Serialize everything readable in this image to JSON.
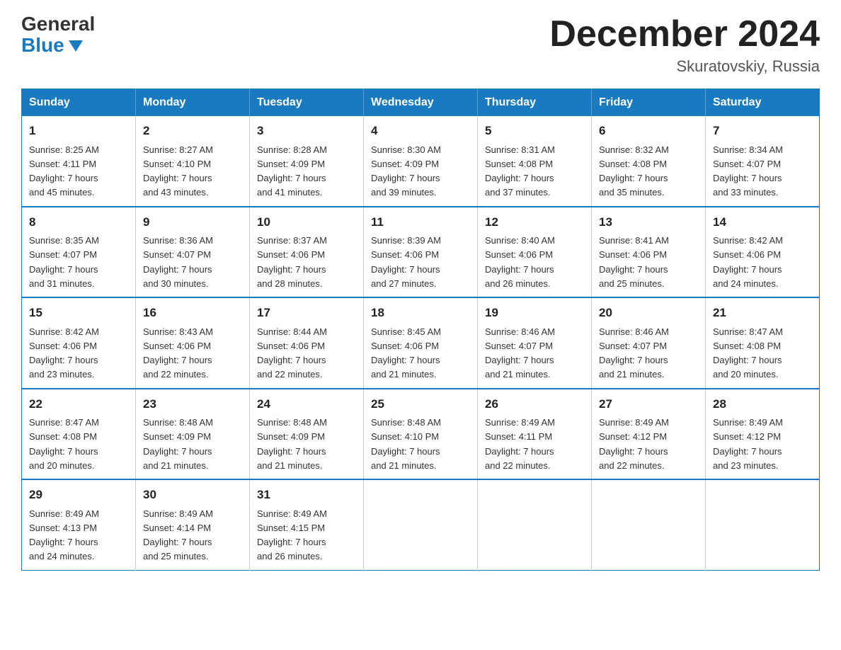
{
  "header": {
    "logo": {
      "general": "General",
      "blue": "Blue"
    },
    "title": "December 2024",
    "location": "Skuratovskiy, Russia"
  },
  "days_of_week": [
    "Sunday",
    "Monday",
    "Tuesday",
    "Wednesday",
    "Thursday",
    "Friday",
    "Saturday"
  ],
  "weeks": [
    [
      {
        "day": "1",
        "sunrise": "8:25 AM",
        "sunset": "4:11 PM",
        "daylight": "7 hours and 45 minutes."
      },
      {
        "day": "2",
        "sunrise": "8:27 AM",
        "sunset": "4:10 PM",
        "daylight": "7 hours and 43 minutes."
      },
      {
        "day": "3",
        "sunrise": "8:28 AM",
        "sunset": "4:09 PM",
        "daylight": "7 hours and 41 minutes."
      },
      {
        "day": "4",
        "sunrise": "8:30 AM",
        "sunset": "4:09 PM",
        "daylight": "7 hours and 39 minutes."
      },
      {
        "day": "5",
        "sunrise": "8:31 AM",
        "sunset": "4:08 PM",
        "daylight": "7 hours and 37 minutes."
      },
      {
        "day": "6",
        "sunrise": "8:32 AM",
        "sunset": "4:08 PM",
        "daylight": "7 hours and 35 minutes."
      },
      {
        "day": "7",
        "sunrise": "8:34 AM",
        "sunset": "4:07 PM",
        "daylight": "7 hours and 33 minutes."
      }
    ],
    [
      {
        "day": "8",
        "sunrise": "8:35 AM",
        "sunset": "4:07 PM",
        "daylight": "7 hours and 31 minutes."
      },
      {
        "day": "9",
        "sunrise": "8:36 AM",
        "sunset": "4:07 PM",
        "daylight": "7 hours and 30 minutes."
      },
      {
        "day": "10",
        "sunrise": "8:37 AM",
        "sunset": "4:06 PM",
        "daylight": "7 hours and 28 minutes."
      },
      {
        "day": "11",
        "sunrise": "8:39 AM",
        "sunset": "4:06 PM",
        "daylight": "7 hours and 27 minutes."
      },
      {
        "day": "12",
        "sunrise": "8:40 AM",
        "sunset": "4:06 PM",
        "daylight": "7 hours and 26 minutes."
      },
      {
        "day": "13",
        "sunrise": "8:41 AM",
        "sunset": "4:06 PM",
        "daylight": "7 hours and 25 minutes."
      },
      {
        "day": "14",
        "sunrise": "8:42 AM",
        "sunset": "4:06 PM",
        "daylight": "7 hours and 24 minutes."
      }
    ],
    [
      {
        "day": "15",
        "sunrise": "8:42 AM",
        "sunset": "4:06 PM",
        "daylight": "7 hours and 23 minutes."
      },
      {
        "day": "16",
        "sunrise": "8:43 AM",
        "sunset": "4:06 PM",
        "daylight": "7 hours and 22 minutes."
      },
      {
        "day": "17",
        "sunrise": "8:44 AM",
        "sunset": "4:06 PM",
        "daylight": "7 hours and 22 minutes."
      },
      {
        "day": "18",
        "sunrise": "8:45 AM",
        "sunset": "4:06 PM",
        "daylight": "7 hours and 21 minutes."
      },
      {
        "day": "19",
        "sunrise": "8:46 AM",
        "sunset": "4:07 PM",
        "daylight": "7 hours and 21 minutes."
      },
      {
        "day": "20",
        "sunrise": "8:46 AM",
        "sunset": "4:07 PM",
        "daylight": "7 hours and 21 minutes."
      },
      {
        "day": "21",
        "sunrise": "8:47 AM",
        "sunset": "4:08 PM",
        "daylight": "7 hours and 20 minutes."
      }
    ],
    [
      {
        "day": "22",
        "sunrise": "8:47 AM",
        "sunset": "4:08 PM",
        "daylight": "7 hours and 20 minutes."
      },
      {
        "day": "23",
        "sunrise": "8:48 AM",
        "sunset": "4:09 PM",
        "daylight": "7 hours and 21 minutes."
      },
      {
        "day": "24",
        "sunrise": "8:48 AM",
        "sunset": "4:09 PM",
        "daylight": "7 hours and 21 minutes."
      },
      {
        "day": "25",
        "sunrise": "8:48 AM",
        "sunset": "4:10 PM",
        "daylight": "7 hours and 21 minutes."
      },
      {
        "day": "26",
        "sunrise": "8:49 AM",
        "sunset": "4:11 PM",
        "daylight": "7 hours and 22 minutes."
      },
      {
        "day": "27",
        "sunrise": "8:49 AM",
        "sunset": "4:12 PM",
        "daylight": "7 hours and 22 minutes."
      },
      {
        "day": "28",
        "sunrise": "8:49 AM",
        "sunset": "4:12 PM",
        "daylight": "7 hours and 23 minutes."
      }
    ],
    [
      {
        "day": "29",
        "sunrise": "8:49 AM",
        "sunset": "4:13 PM",
        "daylight": "7 hours and 24 minutes."
      },
      {
        "day": "30",
        "sunrise": "8:49 AM",
        "sunset": "4:14 PM",
        "daylight": "7 hours and 25 minutes."
      },
      {
        "day": "31",
        "sunrise": "8:49 AM",
        "sunset": "4:15 PM",
        "daylight": "7 hours and 26 minutes."
      },
      {
        "day": "",
        "sunrise": "",
        "sunset": "",
        "daylight": ""
      },
      {
        "day": "",
        "sunrise": "",
        "sunset": "",
        "daylight": ""
      },
      {
        "day": "",
        "sunrise": "",
        "sunset": "",
        "daylight": ""
      },
      {
        "day": "",
        "sunrise": "",
        "sunset": "",
        "daylight": ""
      }
    ]
  ]
}
